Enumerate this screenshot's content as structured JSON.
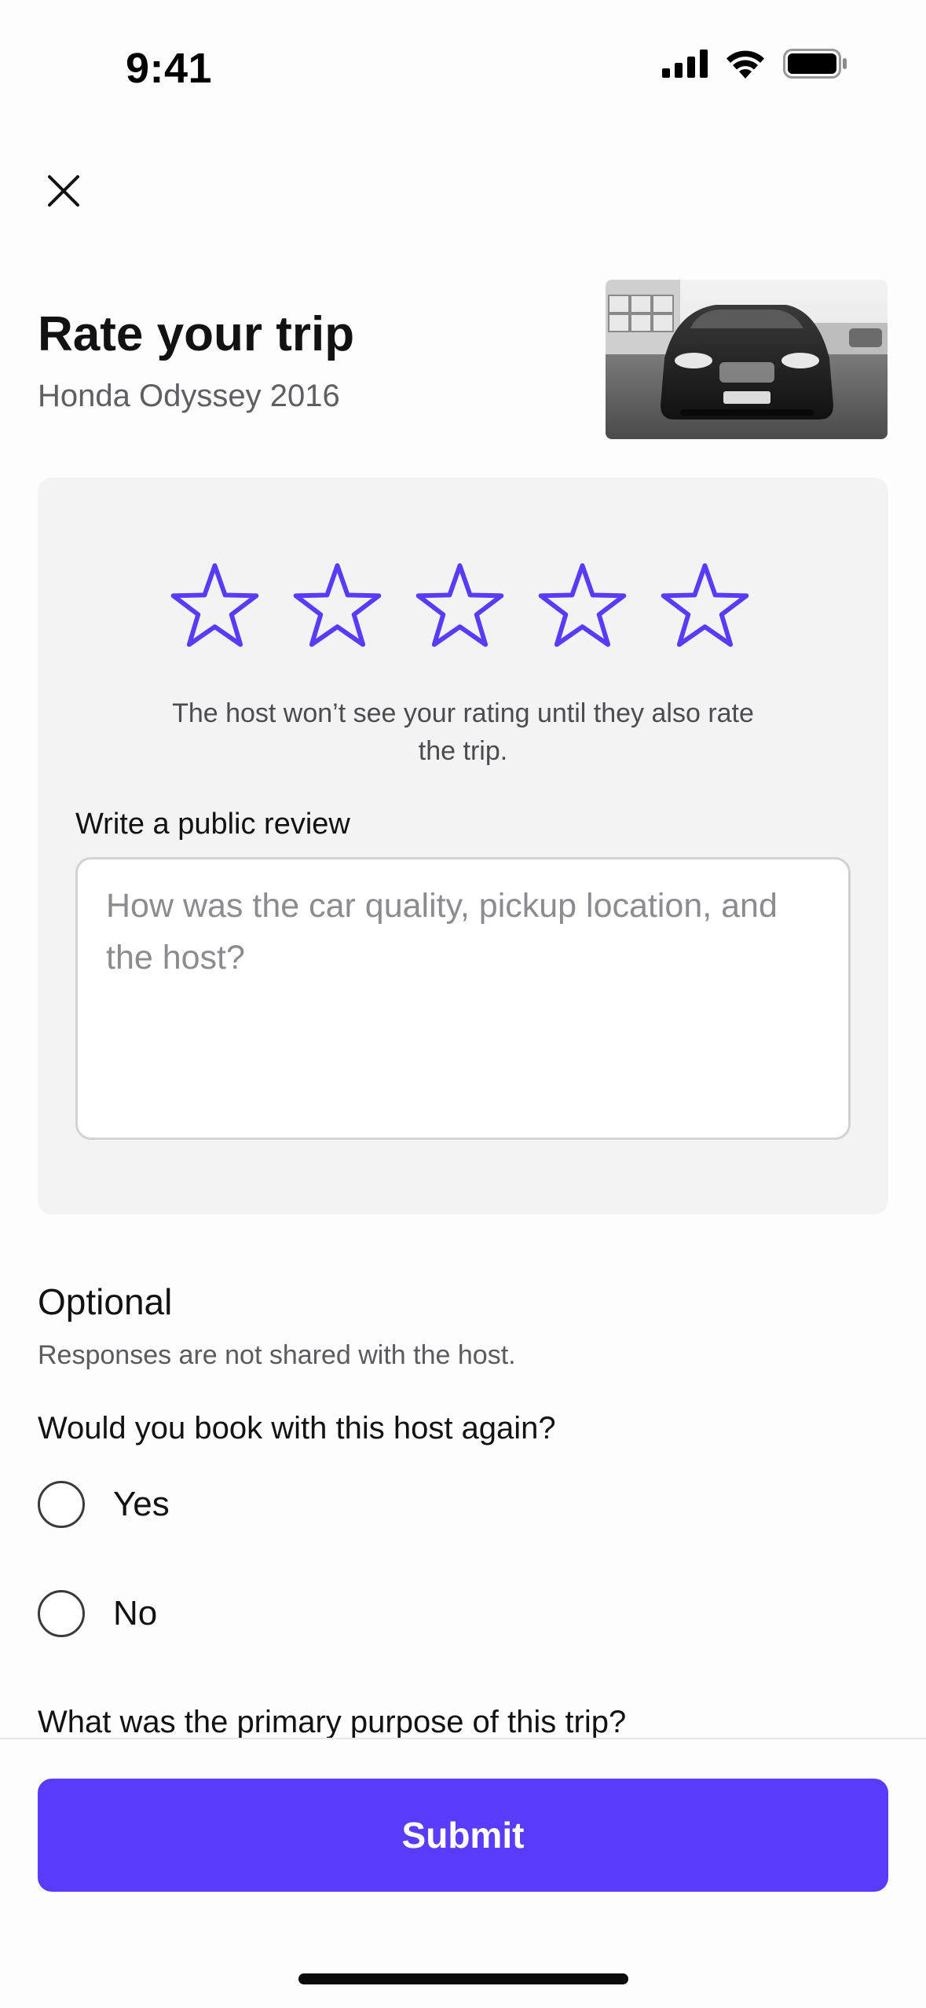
{
  "status_bar": {
    "time": "9:41",
    "icons": [
      "cellular-signal-icon",
      "wifi-icon",
      "battery-icon"
    ]
  },
  "close_icon": "close-icon",
  "header": {
    "title": "Rate your trip",
    "subtitle": "Honda Odyssey 2016",
    "photo": "car-photo"
  },
  "rating": {
    "stars": 5,
    "selected": 0,
    "star_color": "#593CFB",
    "note": "The host won’t see your rating until they also rate the trip.",
    "review_label": "Write a public review",
    "review_placeholder": "How was the car quality, pickup location, and the host?",
    "review_value": ""
  },
  "optional": {
    "title": "Optional",
    "note": "Responses are not shared with the host.",
    "question": "Would you book with this host again?",
    "options": [
      "Yes",
      "No"
    ],
    "selected_option": null,
    "next_question": "What was the primary purpose of this trip?"
  },
  "submit": {
    "label": "Submit",
    "color": "#593CFB"
  }
}
